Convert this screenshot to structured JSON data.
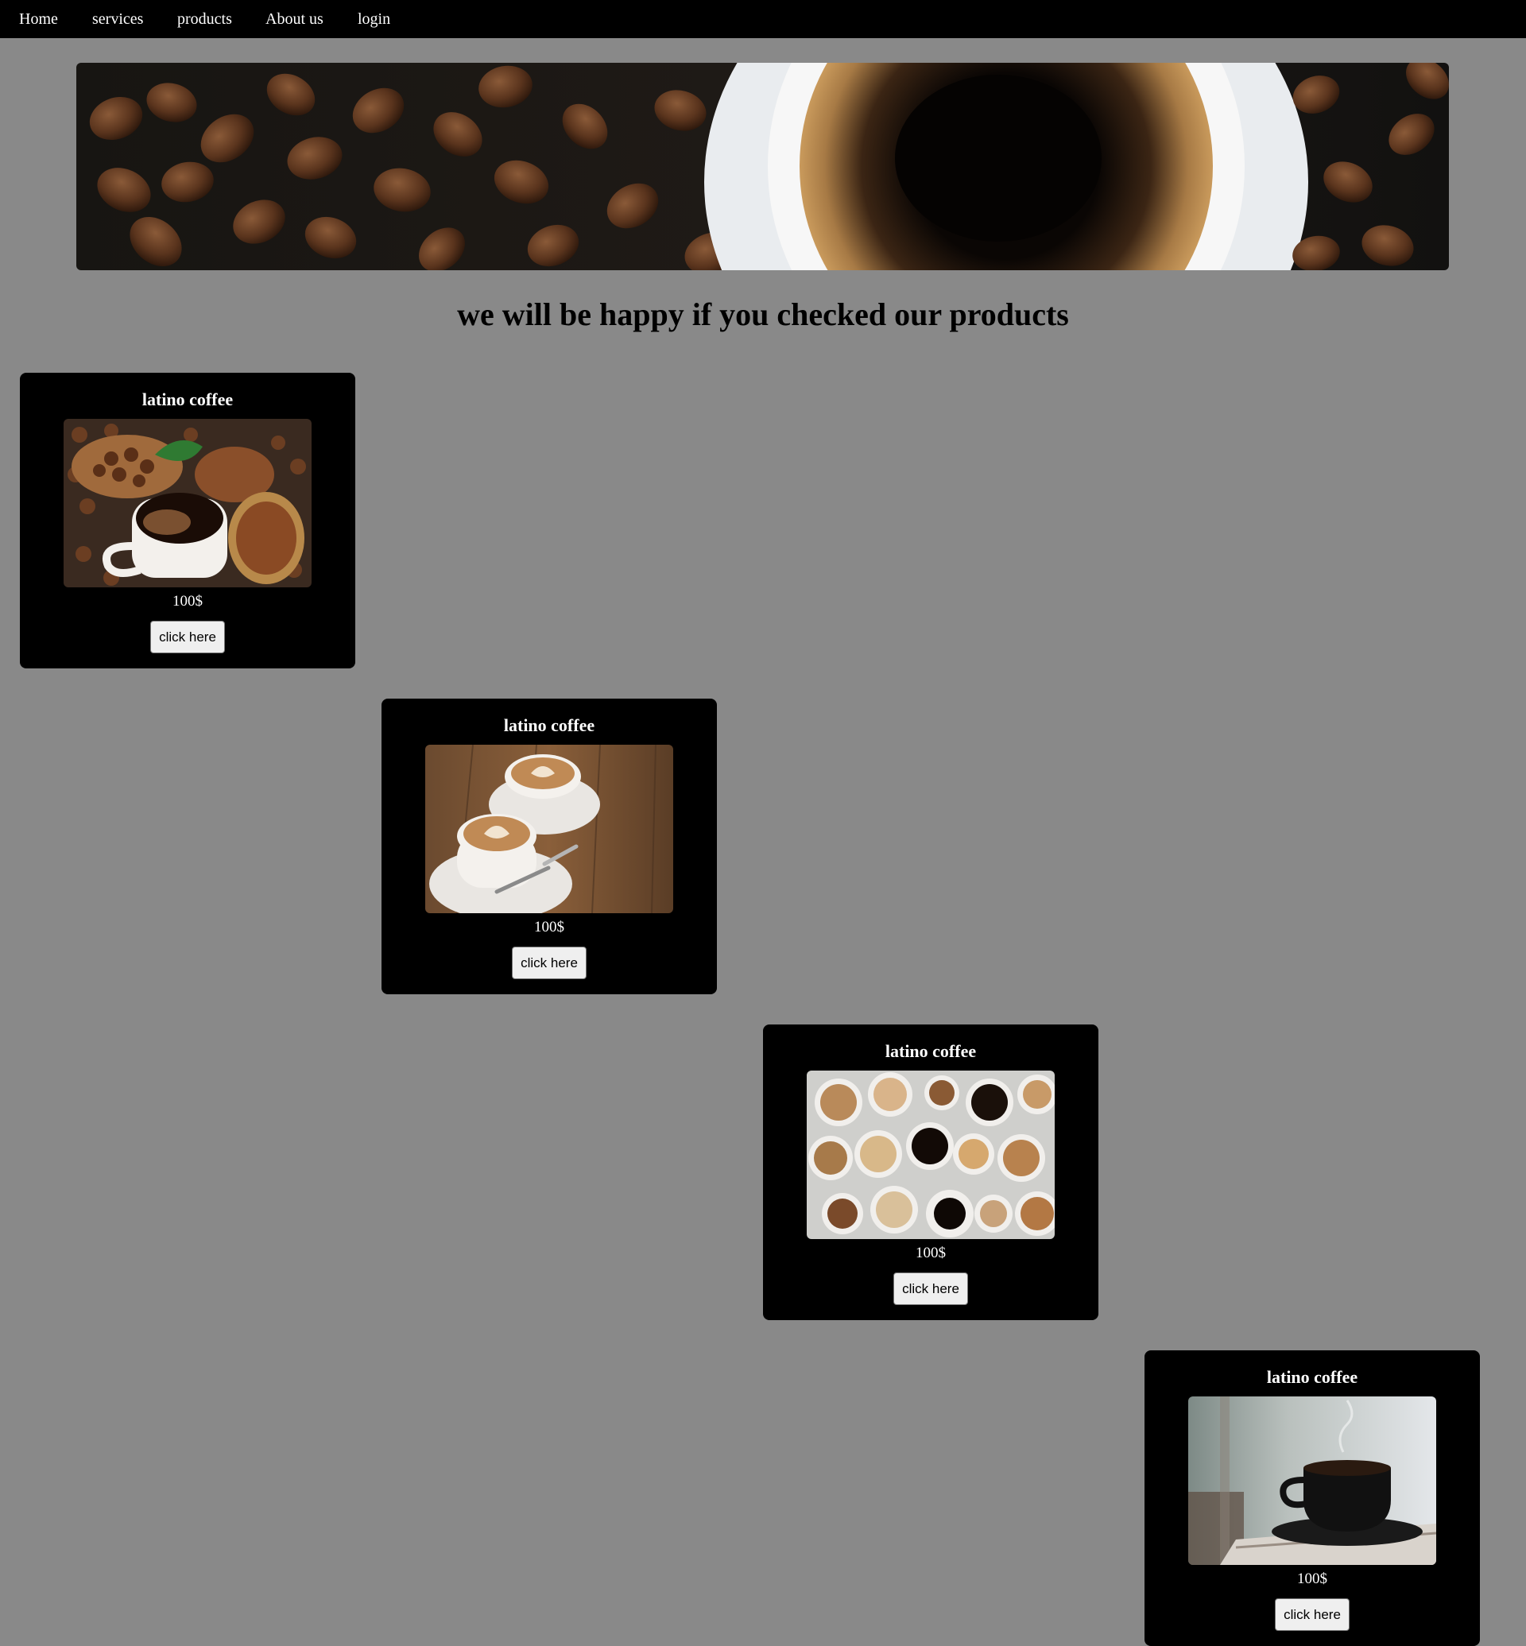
{
  "nav": {
    "items": [
      {
        "label": "Home"
      },
      {
        "label": "services"
      },
      {
        "label": "products"
      },
      {
        "label": "About us"
      },
      {
        "label": "login"
      }
    ]
  },
  "hero": {
    "image": "coffee-beans-and-cup-banner"
  },
  "main": {
    "headline": "we will be happy if you checked our products"
  },
  "products": [
    {
      "title": "latino coffee",
      "price": "100$",
      "button_label": "click here",
      "image": "coffee-cup-with-beans-and-ground-coffee"
    },
    {
      "title": "latino coffee",
      "price": "100$",
      "button_label": "click here",
      "image": "two-cappuccino-cups-on-wood"
    },
    {
      "title": "latino coffee",
      "price": "100$",
      "button_label": "click here",
      "image": "assorted-coffee-cups-top-view"
    },
    {
      "title": "latino coffee",
      "price": "100$",
      "button_label": "click here",
      "image": "black-coffee-cup-on-table"
    }
  ],
  "colors": {
    "page_background": "#898989",
    "navbar_background": "#000000",
    "card_background": "#000000",
    "text_light": "#ffffff",
    "button_background": "#efefef"
  }
}
